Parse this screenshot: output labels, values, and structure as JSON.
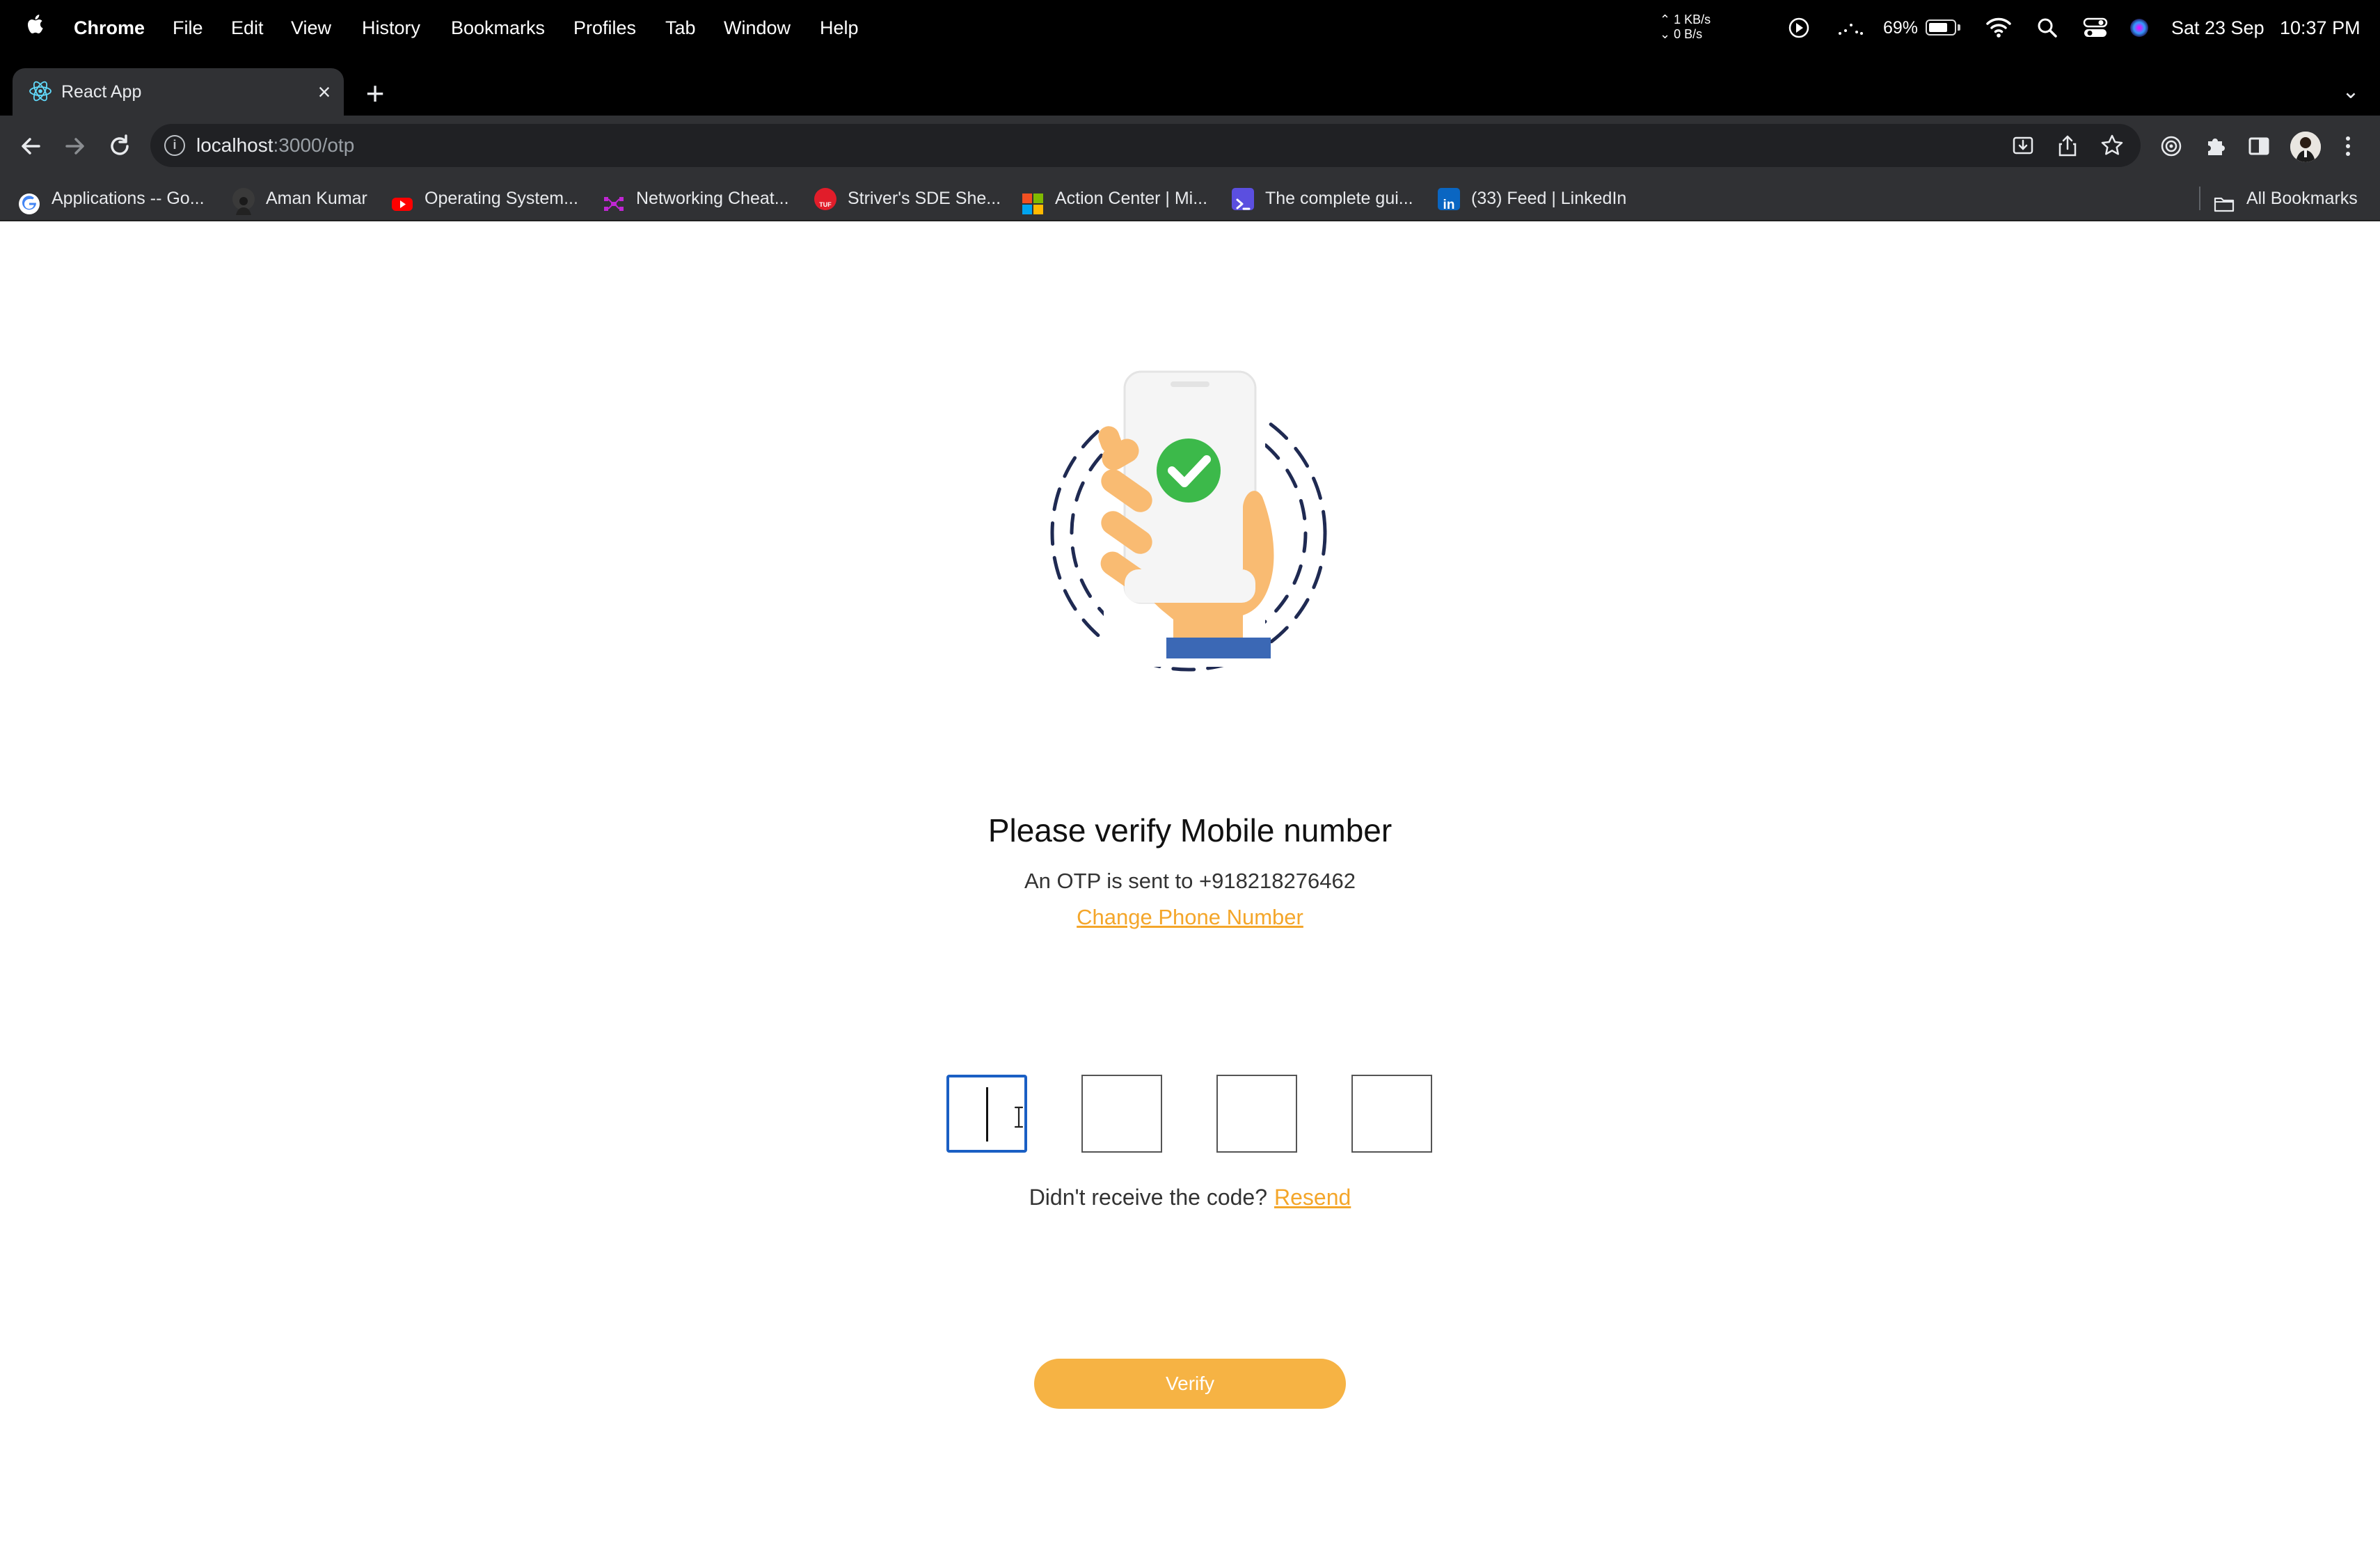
{
  "menubar": {
    "app_name": "Chrome",
    "menus": [
      "File",
      "Edit",
      "View",
      "History",
      "Bookmarks",
      "Profiles",
      "Tab",
      "Window",
      "Help"
    ],
    "net_up": "1 KB/s",
    "net_down": "0 B/s",
    "battery": "69%",
    "date": "Sat 23 Sep",
    "time": "10:37 PM"
  },
  "browser": {
    "tab_title": "React App",
    "url_host": "localhost",
    "url_path": ":3000/otp"
  },
  "bookmarks": {
    "items": [
      {
        "label": "Applications -- Go...",
        "icon": "google-icon",
        "color": "#ffffff"
      },
      {
        "label": "Aman Kumar",
        "icon": "avatar-icon",
        "color": "#444444"
      },
      {
        "label": "Operating System...",
        "icon": "youtube-icon",
        "color": "#ff0000"
      },
      {
        "label": "Networking Cheat...",
        "icon": "network-icon",
        "color": "#c026d3"
      },
      {
        "label": "Striver's SDE She...",
        "icon": "tuf-icon",
        "color": "#e11d2a"
      },
      {
        "label": "Action Center | Mi...",
        "icon": "microsoft-icon",
        "color": "#f25022"
      },
      {
        "label": "The complete gui...",
        "icon": "terminal-icon",
        "color": "#5b4fe0"
      },
      {
        "label": "(33) Feed | LinkedIn",
        "icon": "linkedin-icon",
        "color": "#0a66c2"
      }
    ],
    "all_bookmarks": "All Bookmarks"
  },
  "page": {
    "heading": "Please verify Mobile number",
    "subtext": "An OTP is sent to +918218276462",
    "change_link": "Change Phone Number",
    "otp_values": [
      "",
      "",
      "",
      ""
    ],
    "resend_prompt": "Didn't receive the code?",
    "resend_link": "Resend",
    "verify_label": "Verify"
  },
  "colors": {
    "accent": "#f4a62a",
    "button": "#f6b344",
    "focus": "#1a5fc4",
    "check": "#3cb94a",
    "cuff": "#3b68b5",
    "dash": "#1f2a52"
  }
}
